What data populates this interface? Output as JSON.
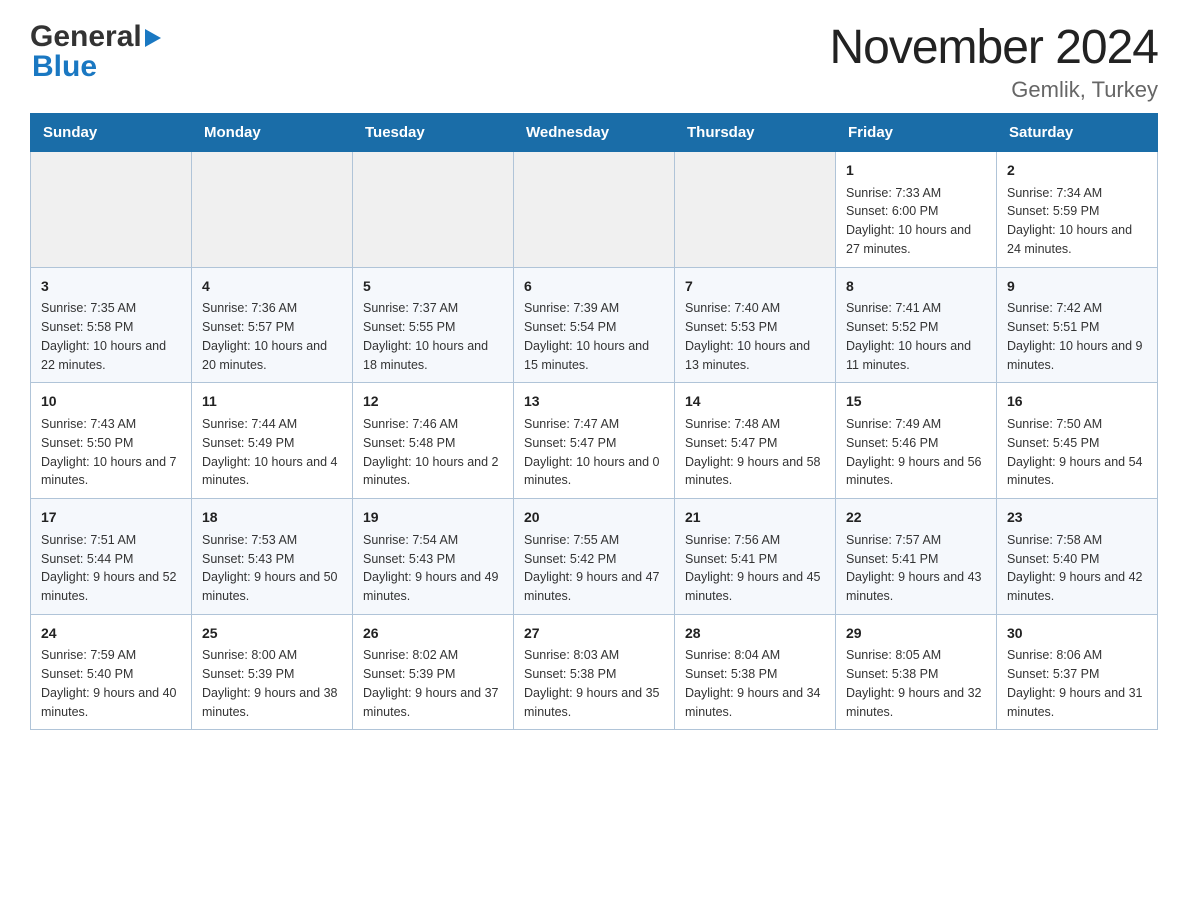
{
  "header": {
    "logo_general": "General",
    "logo_blue": "Blue",
    "month_title": "November 2024",
    "location": "Gemlik, Turkey"
  },
  "days_of_week": [
    "Sunday",
    "Monday",
    "Tuesday",
    "Wednesday",
    "Thursday",
    "Friday",
    "Saturday"
  ],
  "weeks": [
    {
      "days": [
        {
          "num": "",
          "info": ""
        },
        {
          "num": "",
          "info": ""
        },
        {
          "num": "",
          "info": ""
        },
        {
          "num": "",
          "info": ""
        },
        {
          "num": "",
          "info": ""
        },
        {
          "num": "1",
          "info": "Sunrise: 7:33 AM\nSunset: 6:00 PM\nDaylight: 10 hours and 27 minutes."
        },
        {
          "num": "2",
          "info": "Sunrise: 7:34 AM\nSunset: 5:59 PM\nDaylight: 10 hours and 24 minutes."
        }
      ]
    },
    {
      "days": [
        {
          "num": "3",
          "info": "Sunrise: 7:35 AM\nSunset: 5:58 PM\nDaylight: 10 hours and 22 minutes."
        },
        {
          "num": "4",
          "info": "Sunrise: 7:36 AM\nSunset: 5:57 PM\nDaylight: 10 hours and 20 minutes."
        },
        {
          "num": "5",
          "info": "Sunrise: 7:37 AM\nSunset: 5:55 PM\nDaylight: 10 hours and 18 minutes."
        },
        {
          "num": "6",
          "info": "Sunrise: 7:39 AM\nSunset: 5:54 PM\nDaylight: 10 hours and 15 minutes."
        },
        {
          "num": "7",
          "info": "Sunrise: 7:40 AM\nSunset: 5:53 PM\nDaylight: 10 hours and 13 minutes."
        },
        {
          "num": "8",
          "info": "Sunrise: 7:41 AM\nSunset: 5:52 PM\nDaylight: 10 hours and 11 minutes."
        },
        {
          "num": "9",
          "info": "Sunrise: 7:42 AM\nSunset: 5:51 PM\nDaylight: 10 hours and 9 minutes."
        }
      ]
    },
    {
      "days": [
        {
          "num": "10",
          "info": "Sunrise: 7:43 AM\nSunset: 5:50 PM\nDaylight: 10 hours and 7 minutes."
        },
        {
          "num": "11",
          "info": "Sunrise: 7:44 AM\nSunset: 5:49 PM\nDaylight: 10 hours and 4 minutes."
        },
        {
          "num": "12",
          "info": "Sunrise: 7:46 AM\nSunset: 5:48 PM\nDaylight: 10 hours and 2 minutes."
        },
        {
          "num": "13",
          "info": "Sunrise: 7:47 AM\nSunset: 5:47 PM\nDaylight: 10 hours and 0 minutes."
        },
        {
          "num": "14",
          "info": "Sunrise: 7:48 AM\nSunset: 5:47 PM\nDaylight: 9 hours and 58 minutes."
        },
        {
          "num": "15",
          "info": "Sunrise: 7:49 AM\nSunset: 5:46 PM\nDaylight: 9 hours and 56 minutes."
        },
        {
          "num": "16",
          "info": "Sunrise: 7:50 AM\nSunset: 5:45 PM\nDaylight: 9 hours and 54 minutes."
        }
      ]
    },
    {
      "days": [
        {
          "num": "17",
          "info": "Sunrise: 7:51 AM\nSunset: 5:44 PM\nDaylight: 9 hours and 52 minutes."
        },
        {
          "num": "18",
          "info": "Sunrise: 7:53 AM\nSunset: 5:43 PM\nDaylight: 9 hours and 50 minutes."
        },
        {
          "num": "19",
          "info": "Sunrise: 7:54 AM\nSunset: 5:43 PM\nDaylight: 9 hours and 49 minutes."
        },
        {
          "num": "20",
          "info": "Sunrise: 7:55 AM\nSunset: 5:42 PM\nDaylight: 9 hours and 47 minutes."
        },
        {
          "num": "21",
          "info": "Sunrise: 7:56 AM\nSunset: 5:41 PM\nDaylight: 9 hours and 45 minutes."
        },
        {
          "num": "22",
          "info": "Sunrise: 7:57 AM\nSunset: 5:41 PM\nDaylight: 9 hours and 43 minutes."
        },
        {
          "num": "23",
          "info": "Sunrise: 7:58 AM\nSunset: 5:40 PM\nDaylight: 9 hours and 42 minutes."
        }
      ]
    },
    {
      "days": [
        {
          "num": "24",
          "info": "Sunrise: 7:59 AM\nSunset: 5:40 PM\nDaylight: 9 hours and 40 minutes."
        },
        {
          "num": "25",
          "info": "Sunrise: 8:00 AM\nSunset: 5:39 PM\nDaylight: 9 hours and 38 minutes."
        },
        {
          "num": "26",
          "info": "Sunrise: 8:02 AM\nSunset: 5:39 PM\nDaylight: 9 hours and 37 minutes."
        },
        {
          "num": "27",
          "info": "Sunrise: 8:03 AM\nSunset: 5:38 PM\nDaylight: 9 hours and 35 minutes."
        },
        {
          "num": "28",
          "info": "Sunrise: 8:04 AM\nSunset: 5:38 PM\nDaylight: 9 hours and 34 minutes."
        },
        {
          "num": "29",
          "info": "Sunrise: 8:05 AM\nSunset: 5:38 PM\nDaylight: 9 hours and 32 minutes."
        },
        {
          "num": "30",
          "info": "Sunrise: 8:06 AM\nSunset: 5:37 PM\nDaylight: 9 hours and 31 minutes."
        }
      ]
    }
  ]
}
